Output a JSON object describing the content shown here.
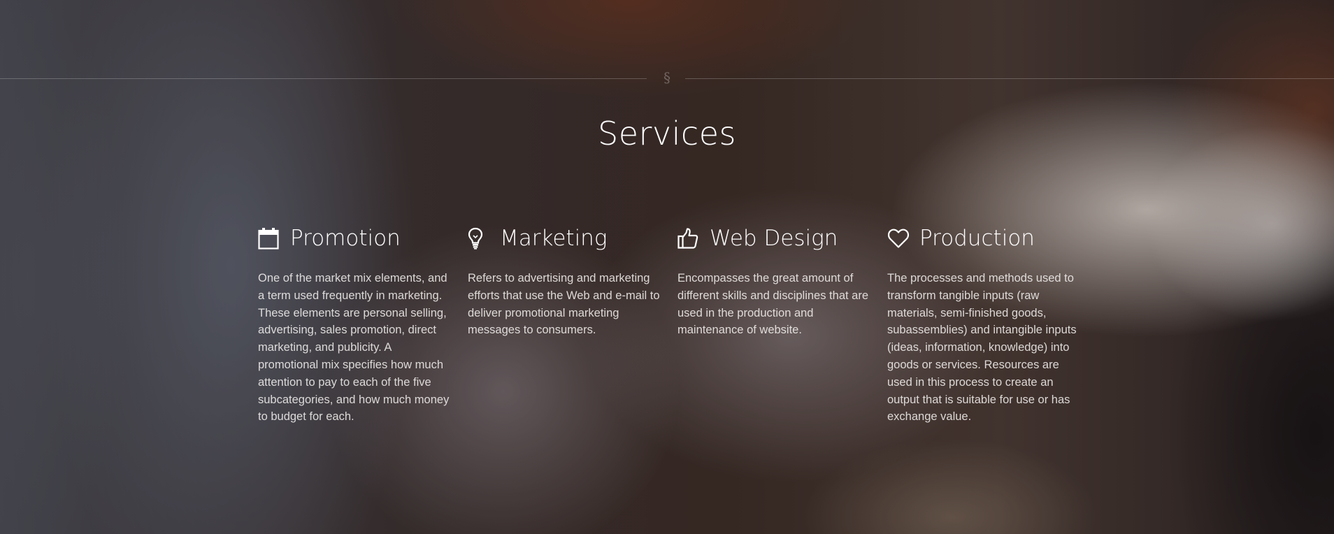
{
  "section": {
    "divider_symbol": "§",
    "title": "Services"
  },
  "services": [
    {
      "icon": "calendar-icon",
      "title": "Promotion",
      "description": "One of the market mix elements, and a term used frequently in marketing. These elements are personal selling, advertising, sales promotion, direct marketing, and publicity. A promotional mix specifies how much attention to pay to each of the five subcategories, and how much money to budget for each."
    },
    {
      "icon": "lightbulb-icon",
      "title": "Marketing",
      "description": "Refers to advertising and marketing efforts that use the Web and e-mail to deliver promotional marketing messages to consumers."
    },
    {
      "icon": "thumbs-up-icon",
      "title": "Web Design",
      "description": "Encompasses the great amount of different skills and disciplines that are used in the production and maintenance of website."
    },
    {
      "icon": "heart-icon",
      "title": "Production",
      "description": "The processes and methods used to transform tangible inputs (raw materials, semi-finished goods, subassemblies) and intangible inputs (ideas, information, knowledge) into goods or services. Resources are used in this process to create an output that is suitable for use or has exchange value."
    }
  ],
  "colors": {
    "text": "#ffffff",
    "body_text": "#f2efed",
    "divider": "#5a5250"
  }
}
